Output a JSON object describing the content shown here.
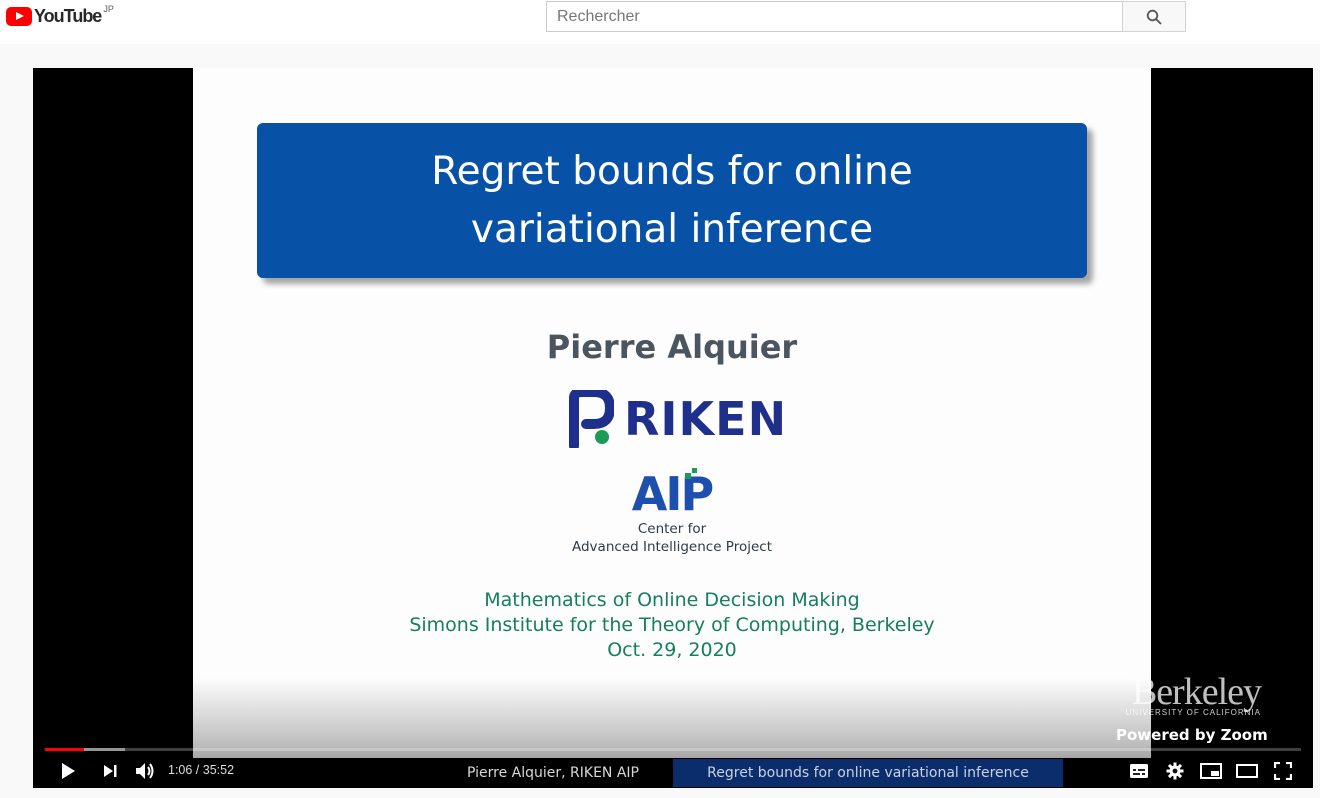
{
  "header": {
    "logo_text": "YouTube",
    "logo_region": "JP",
    "search": {
      "placeholder": "Rechercher",
      "value": ""
    }
  },
  "slide": {
    "title": "Regret bounds for online variational inference",
    "author": "Pierre Alquier",
    "riken_logo_text": "RIKEN",
    "aip_logo_text": "AIP",
    "aip_line1": "Center for",
    "aip_line2": "Advanced Intelligence Project",
    "event_line1": "Mathematics of Online Decision Making",
    "event_line2": "Simons Institute for the Theory of Computing, Berkeley",
    "event_line3": "Oct. 29, 2020"
  },
  "watermark": {
    "berkeley": "Berkeley",
    "berkeley_sub": "UNIVERSITY OF CALIFORNIA",
    "powered": "Powered by Zoom"
  },
  "player": {
    "time": "1:06 / 35:52",
    "progress_played": 0.031,
    "progress_loaded": 0.064,
    "speaker_strip": "Pierre Alquier, RIKEN AIP",
    "title_strip": "Regret bounds for online variational inference"
  },
  "colors": {
    "title_box": "#0751a6",
    "event_text": "#157f5a",
    "progress": "#ff0000"
  }
}
